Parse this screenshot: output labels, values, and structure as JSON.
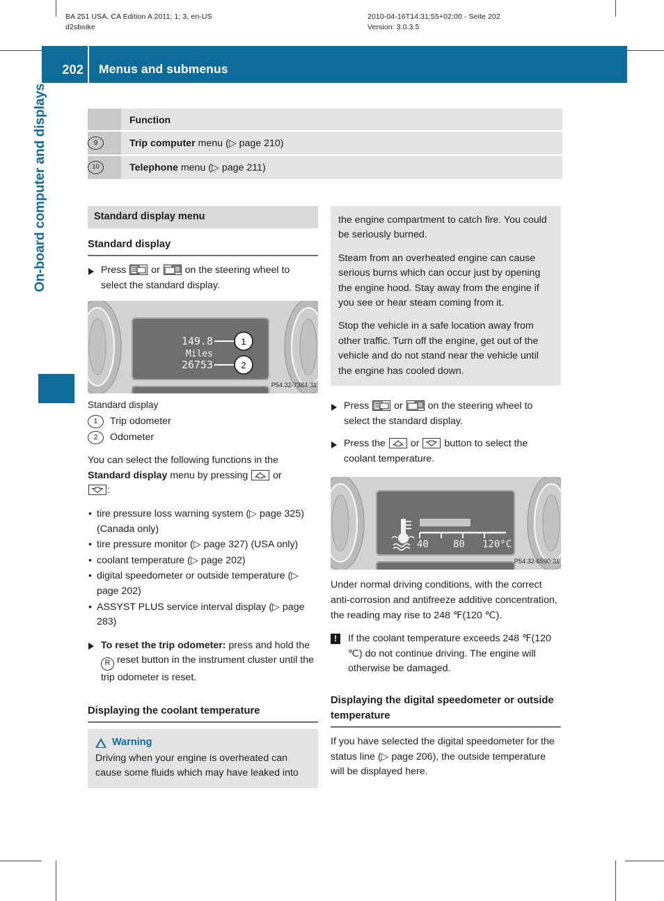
{
  "meta": {
    "left_line1": "BA 251 USA, CA Edition A 2011; 1; 3, en-US",
    "left_line2": "d2sboike",
    "right_line1": "2010-04-16T14:31:55+02:00 - Seite 202",
    "right_line2": "Version: 3.0.3.5"
  },
  "header": {
    "page_number": "202",
    "title": "Menus and submenus"
  },
  "sidebar": {
    "chapter": "On-board computer and displays"
  },
  "function_table": {
    "header": "Function",
    "rows": [
      {
        "num": "9",
        "bold": "Trip computer",
        "rest": " menu (▷ page 210)"
      },
      {
        "num": "10",
        "bold": "Telephone",
        "rest": " menu (▷ page 211)"
      }
    ]
  },
  "left_column": {
    "band_heading": "Standard display menu",
    "sub_heading": "Standard display",
    "step1_pre": "Press ",
    "step1_mid": " or ",
    "step1_post": " on the steering wheel to select the standard display.",
    "figure1": {
      "code": "P54.32-7384-31",
      "display_trip": "149.8",
      "display_unit": "Miles",
      "display_odo": "26753",
      "callout1": "1",
      "callout2": "2"
    },
    "fig1_caption": "Standard display",
    "legend": [
      {
        "num": "1",
        "label": "Trip odometer"
      },
      {
        "num": "2",
        "label": "Odometer"
      }
    ],
    "intro_part1": "You can select the following functions in the ",
    "intro_bold": "Standard display",
    "intro_part2": " menu by pressing ",
    "intro_part3": " or ",
    "intro_part4": ":",
    "bullets": [
      "tire pressure loss warning system (▷ page 325) (Canada only)",
      "tire pressure monitor (▷ page 327) (USA only)",
      "coolant temperature (▷ page 202)",
      "digital speedometer or outside temperature (▷ page 202)",
      "ASSYST PLUS service interval display (▷ page 283)"
    ],
    "reset_bold": "To reset the trip odometer:",
    "reset_pre": " press and hold the ",
    "reset_btn": "R",
    "reset_post": " reset button in the instrument cluster until the trip odometer is reset.",
    "coolant_heading": "Displaying the coolant temperature",
    "warning_title": "Warning",
    "warning_text_part1": "Driving when your engine is overheated can cause some fluids which may have leaked into"
  },
  "right_column": {
    "warning_cont_p1": "the engine compartment to catch fire. You could be seriously burned.",
    "warning_cont_p2": "Steam from an overheated engine can cause serious burns which can occur just by opening the engine hood. Stay away from the engine if you see or hear steam coming from it.",
    "warning_cont_p3": "Stop the vehicle in a safe location away from other traffic. Turn off the engine, get out of the vehicle and do not stand near the vehicle until the engine has cooled down.",
    "step1_pre": "Press ",
    "step1_mid": " or ",
    "step1_post": " on the steering wheel to select the standard display.",
    "step2_pre": "Press the ",
    "step2_mid": " or ",
    "step2_post": " button to select the coolant temperature.",
    "figure2": {
      "code": "P54.32-6590-31",
      "scale_labels": [
        "40",
        "80",
        "120°C"
      ]
    },
    "paragraph1": "Under normal driving conditions, with the correct anti-corrosion and antifreeze additive concentration, the reading may rise to 248 ℉(120 ℃).",
    "notice_mark": "!",
    "notice_text": "If the coolant temperature exceeds 248 ℉(120 ℃) do not continue driving. The engine will otherwise be damaged.",
    "speedo_heading": "Displaying the digital speedometer or outside temperature",
    "paragraph2": "If you have selected the digital speedometer for the status line (▷ page 206), the outside temperature will be displayed here."
  },
  "colors": {
    "brand_blue": "#0d6c9c",
    "band_gray": "#d9d9d9",
    "box_gray": "#e4e4e4",
    "cell_gray": "#c9c9c9"
  }
}
